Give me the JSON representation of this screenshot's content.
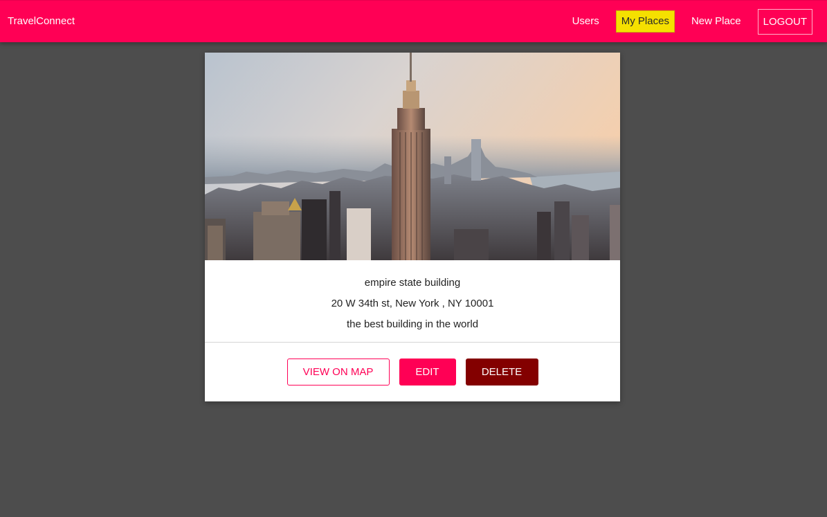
{
  "header": {
    "brand": "TravelConnect",
    "nav": {
      "users": "Users",
      "my_places": "My Places",
      "new_place": "New Place",
      "logout": "LOGOUT"
    }
  },
  "place": {
    "title": "empire state building",
    "address": "20 W 34th st, New York , NY 10001",
    "description": "the best building in the world",
    "actions": {
      "view_on_map": "VIEW ON MAP",
      "edit": "EDIT",
      "delete": "DELETE"
    }
  },
  "colors": {
    "brand": "#ff0055",
    "active_nav": "#f5e000",
    "danger": "#830000",
    "background": "#4d4d4d"
  }
}
